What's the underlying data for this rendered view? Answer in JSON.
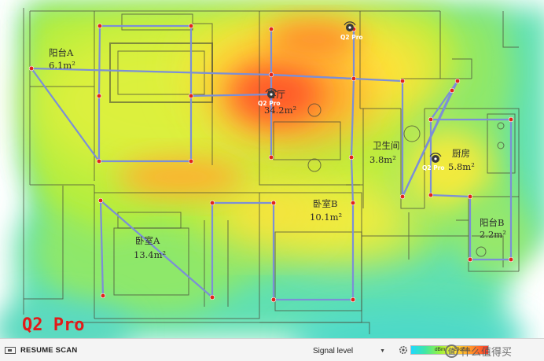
{
  "floorplan": {
    "rooms": [
      {
        "name": "阳台A",
        "area": "6.1m²"
      },
      {
        "name": "客厅",
        "area": "34.2m²"
      },
      {
        "name": "卫生间",
        "area": "3.8m²"
      },
      {
        "name": "厨房",
        "area": "5.8m²"
      },
      {
        "name": "卧室B",
        "area": "10.1m²"
      },
      {
        "name": "卧室A",
        "area": "13.4m²"
      },
      {
        "name": "阳台B",
        "area": "2.2m²"
      }
    ],
    "access_points": [
      {
        "label": "Q2 Pro"
      },
      {
        "label": "Q2 Pro"
      },
      {
        "label": "Q2 Pro"
      }
    ],
    "brand_label": "Q2 Pro"
  },
  "bottom_bar": {
    "resume_label": "RESUME SCAN",
    "view_mode": "Signal level",
    "legend_low": "dBm",
    "legend_high": "-20dBm"
  },
  "watermark": {
    "logo_char": "值",
    "text": "什么值得买"
  },
  "colors": {
    "survey_path": "#7c8fd6",
    "survey_point": "#e0241b",
    "brand_text": "#e21a1a"
  }
}
